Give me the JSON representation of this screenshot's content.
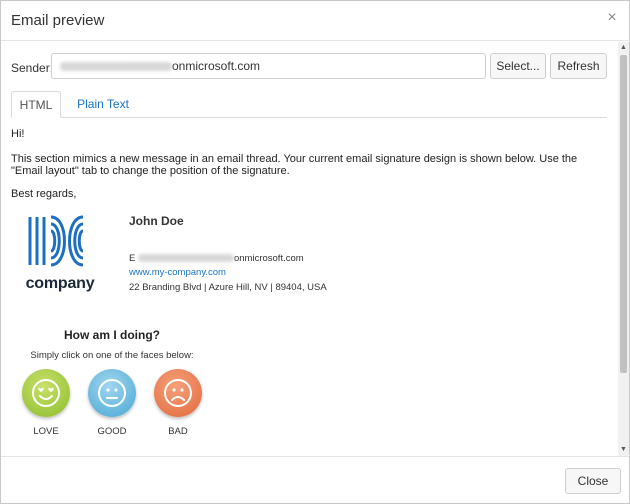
{
  "dialog": {
    "title": "Email preview",
    "close_glyph": "×"
  },
  "sender": {
    "label": "Sender:",
    "value_suffix": "onmicrosoft.com",
    "select_label": "Select...",
    "refresh_label": "Refresh"
  },
  "tabs": [
    {
      "label": "HTML",
      "active": true
    },
    {
      "label": "Plain Text",
      "active": false
    }
  ],
  "message": {
    "greeting": "Hi!",
    "paragraph": "This section mimics a new message in an email thread. Your current email signature design is shown below. Use the \"Email layout\" tab to change the position of the signature.",
    "closing": "Best regards,"
  },
  "signature": {
    "logo_text": "company",
    "name": "John Doe",
    "email_prefix": "E",
    "email_suffix": "onmicrosoft.com",
    "website": "www.my-company.com",
    "address": "22 Branding Blvd | Azure Hill, NV | 89404, USA"
  },
  "survey": {
    "title": "How am I doing?",
    "subtitle": "Simply click on one of the faces below:",
    "options": [
      {
        "label": "LOVE",
        "icon": "heart-eyes-face-icon",
        "color": "#8cbd2b"
      },
      {
        "label": "GOOD",
        "icon": "neutral-face-icon",
        "color": "#4aa7d4"
      },
      {
        "label": "BAD",
        "icon": "sad-face-icon",
        "color": "#e0693c"
      }
    ]
  },
  "footer": {
    "close_label": "Close"
  },
  "colors": {
    "link": "#1a73c8",
    "logo_blue": "#1e6fc4",
    "logo_text": "#1b2838"
  }
}
